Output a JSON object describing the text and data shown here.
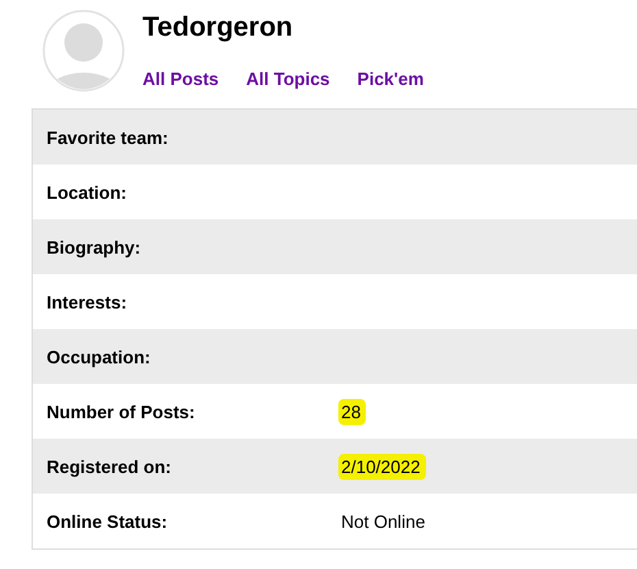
{
  "profile": {
    "username": "Tedorgeron",
    "links": [
      "All Posts",
      "All Topics",
      "Pick'em"
    ]
  },
  "fields": [
    {
      "label": "Favorite team:"
    },
    {
      "label": "Location:"
    },
    {
      "label": "Biography:"
    },
    {
      "label": "Interests:"
    },
    {
      "label": "Occupation:"
    },
    {
      "label": "Number of Posts:",
      "value": "28",
      "highlighted": true
    },
    {
      "label": "Registered on:",
      "value": "2/10/2022",
      "highlighted": true
    },
    {
      "label": "Online Status:",
      "value": "Not Online",
      "highlighted": false
    }
  ]
}
